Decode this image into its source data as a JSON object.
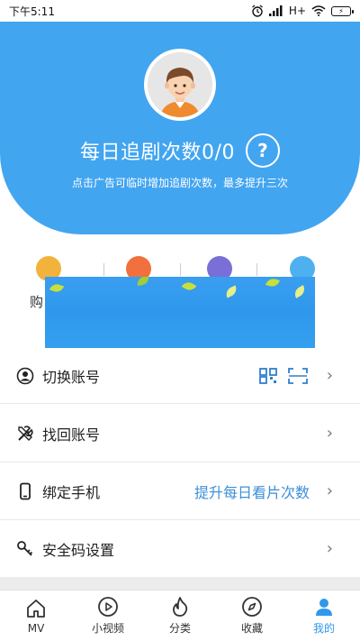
{
  "status_bar": {
    "time": "下午5:11",
    "network": "H+",
    "alarm_icon": "alarm-icon",
    "signal_icon": "signal-icon",
    "wifi_icon": "wifi-icon",
    "battery_icon": "battery-icon"
  },
  "header": {
    "avatar_icon": "boy-avatar-icon",
    "daily_count": "每日追剧次数0/0",
    "help_symbol": "?",
    "subtitle": "点击广告可临时增加追剧次数，最多提升三次",
    "background_color": "#42a5f0"
  },
  "quick_actions": {
    "first_label_partial": "购",
    "items": [
      {
        "icon": "crown-icon",
        "color": "#f2b33d"
      },
      {
        "icon": "gift-icon",
        "color": "#f2703d"
      },
      {
        "icon": "box-icon",
        "color": "#7a6fd6"
      },
      {
        "icon": "pencil-icon",
        "color": "#4fb0f0"
      }
    ]
  },
  "menu": [
    {
      "icon": "user-circle-icon",
      "label": "切换账号",
      "right_text": "",
      "qr_icons": true
    },
    {
      "icon": "tools-icon",
      "label": "找回账号",
      "right_text": ""
    },
    {
      "icon": "phone-icon",
      "label": "绑定手机",
      "right_text": "提升每日看片次数"
    },
    {
      "icon": "key-icon",
      "label": "安全码设置",
      "right_text": ""
    }
  ],
  "bottom_nav": [
    {
      "label": "MV",
      "icon": "home-icon",
      "active": false
    },
    {
      "label": "小视频",
      "icon": "play-circle-icon",
      "active": false
    },
    {
      "label": "分类",
      "icon": "flame-icon",
      "active": false
    },
    {
      "label": "收藏",
      "icon": "compass-icon",
      "active": false
    },
    {
      "label": "我的",
      "icon": "person-icon",
      "active": true
    }
  ],
  "accent_color": "#2f98ec"
}
